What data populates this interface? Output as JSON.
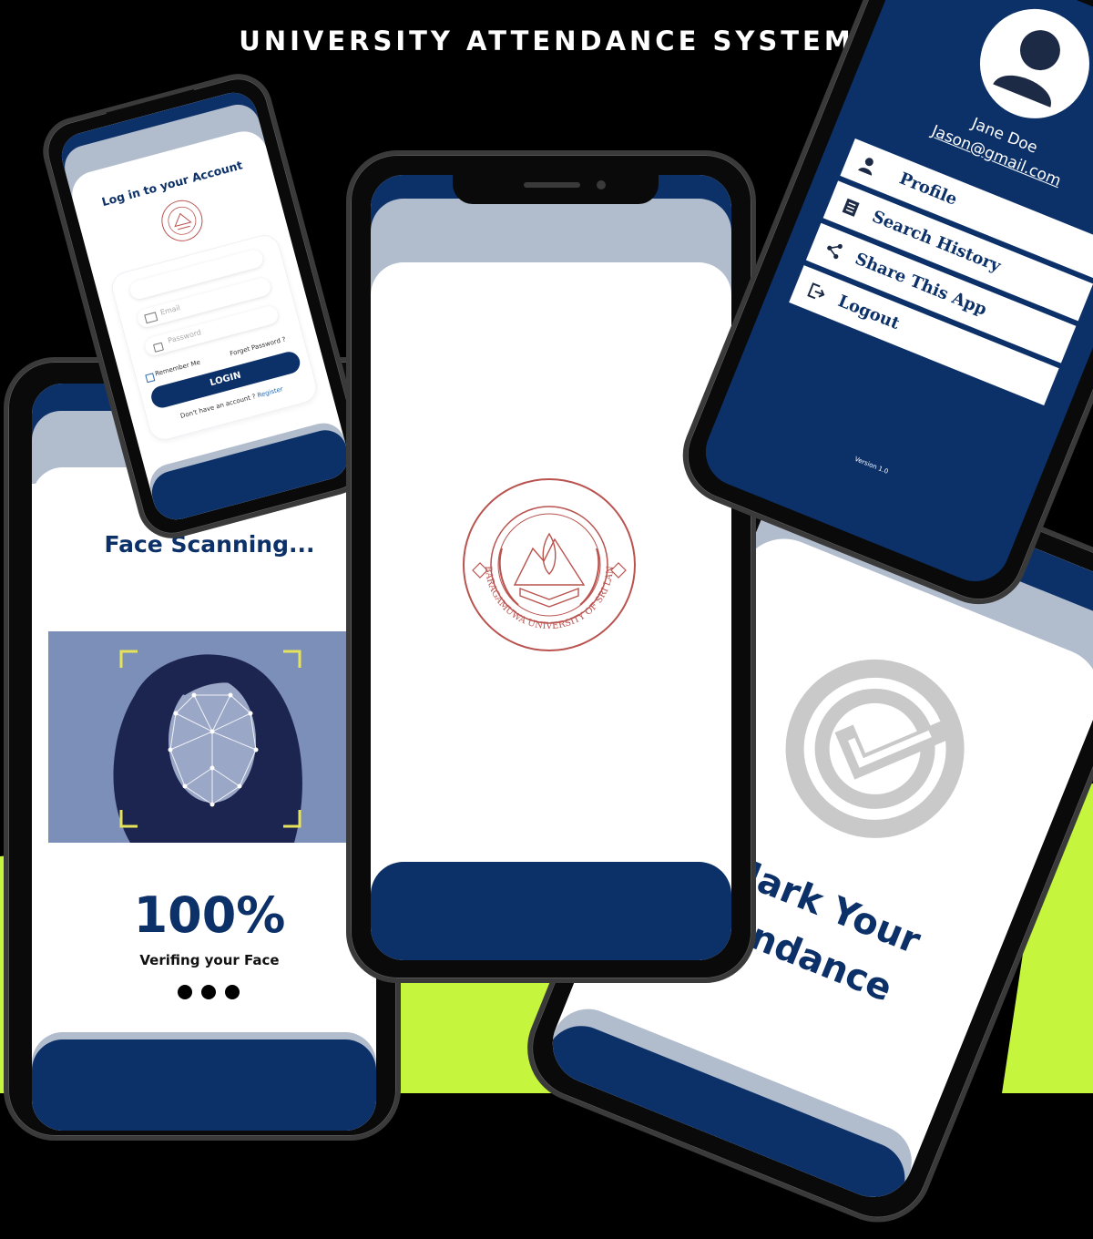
{
  "header": {
    "title": "UNIVERSITY ATTENDANCE SYSTEM"
  },
  "colors": {
    "navy": "#0c3068",
    "slate": "#b1bccd",
    "lime": "#c6f53d",
    "seal_red": "#b9534f"
  },
  "login_screen": {
    "title": "Log in to your Account",
    "email_placeholder": "Email",
    "password_placeholder": "Password",
    "remember_label": "Remember Me",
    "forgot_label": "Forget Password ?",
    "login_button": "LOGIN",
    "no_account": "Don't have an account ?",
    "register_link": "Register"
  },
  "splash_screen": {
    "seal_outer_text": "SABARAGAMUWA UNIVERSITY OF SRI LANKA"
  },
  "scan_screen": {
    "title": "Face Scanning...",
    "percent": "100%",
    "subtitle": "Verifing your Face",
    "progress_dots": 3
  },
  "drawer_screen": {
    "user_name": "Jane Doe",
    "user_email": "Jason@gmail.com",
    "menu": [
      {
        "label": "Profile",
        "icon": "person-icon"
      },
      {
        "label": "Search History",
        "icon": "book-icon"
      },
      {
        "label": "Share This App",
        "icon": "share-icon"
      },
      {
        "label": "Logout",
        "icon": "logout-icon"
      }
    ],
    "version": "Version 1.0"
  },
  "attendance_screen": {
    "line1": "Mark Your",
    "line2": "tendance"
  }
}
